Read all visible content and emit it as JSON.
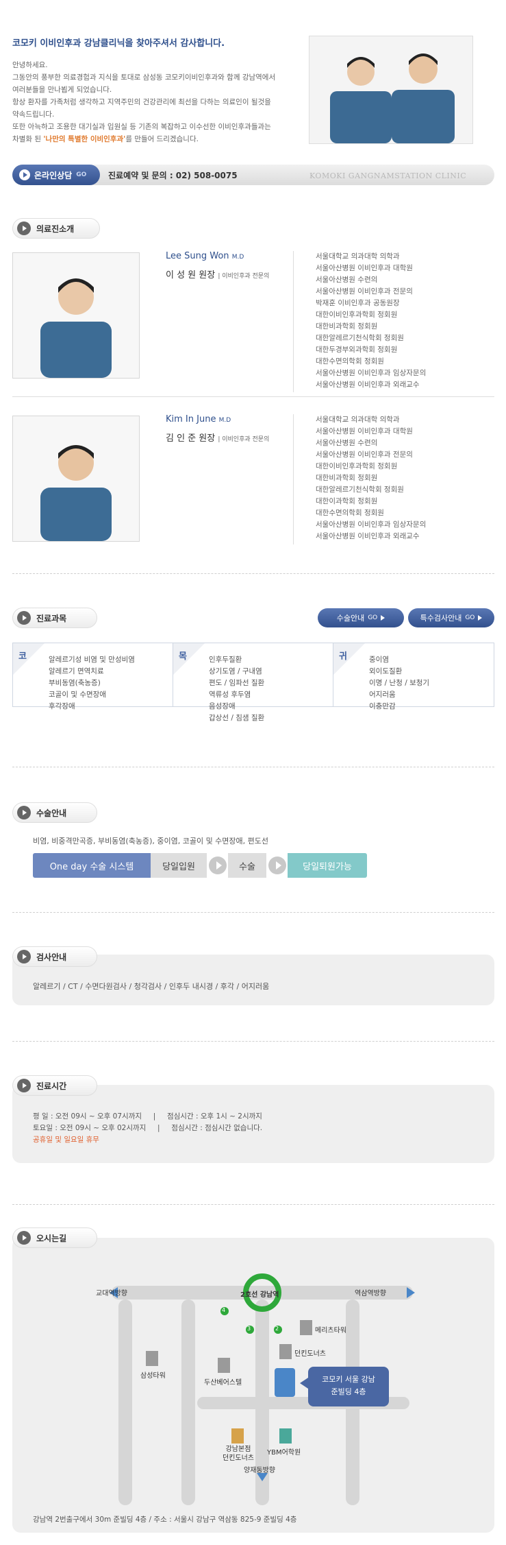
{
  "intro": {
    "title": "코모키 이비인후과 강남클리닉을 찾아주셔서 감사합니다.",
    "p1": "안녕하세요.",
    "p2": "그동안의 풍부한 의료경험과 지식을 토대로 삼성동 코모키이비인후과와 함께 강남역에서",
    "p3": "여러분들을 만나뵙게 되었습니다.",
    "p4": "항상 환자를 가족처럼 생각하고 지역주민의 건강관리에 최선을 다하는 의료인이 될것을",
    "p5": "약속드립니다.",
    "p6": "또한 아늑하고 조용한 대기실과 입원실 등 기존의 복잡하고 이수선한 이비인후과들과는",
    "p7_a": "차별화 된 ",
    "p7_hl": "'나만의 특별한 이비인후과'",
    "p7_b": "를 만들어 드리겠습니다."
  },
  "contact": {
    "online_label": "온라인상담",
    "online_go": "GO",
    "phone_label": "진료예약 및 문의 : 02) 508-0075",
    "brand_en": "KOMOKI GANGNAMSTATION CLINIC"
  },
  "sections": {
    "doctors": "의료진소개",
    "departments": "진료과목",
    "surgery": "수술안내",
    "exam": "검사안내",
    "hours": "진료시간",
    "directions": "오시는길"
  },
  "doctors": [
    {
      "name_en": "Lee Sung Won",
      "md": "M.D",
      "name_ko": "이 성 원 원장",
      "spec": "이비인후과 전문의",
      "career": [
        "서울대학교 의과대학 의학과",
        "서울아산병원 이비인후과 대학원",
        "서울아산병원 수련의",
        "서울아산병원 이비인후과 전문의",
        "박재훈 이비인후과 공동원장",
        "대한이비인후과학회 정회원",
        "대한비과학회 정회원",
        "대한알레르기천식학회 정회원",
        "대한두경부외과학회 정회원",
        "대한수면의학회 정회원",
        "서울아산병원 이비인후과 임상자문의",
        "서울아산병원 이비인후과 외래교수"
      ]
    },
    {
      "name_en": "Kim In June",
      "md": "M.D",
      "name_ko": "김 인 준 원장",
      "spec": "이비인후과 전문의",
      "career": [
        "서울대학교 의과대학 의학과",
        "서울아산병원 이비인후과 대학원",
        "서울아산병원 수련의",
        "서울아산병원 이비인후과 전문의",
        "대한이비인후과학회 정회원",
        "대한비과학회 정회원",
        "대한알레르기천식학회 정회원",
        "대한이과학회 정회원",
        "대한수면의학회 정회원",
        "서울아산병원 이비인후과 임상자문의",
        "서울아산병원 이비인후과 외래교수"
      ]
    }
  ],
  "dept_buttons": {
    "surgery": "수술안내",
    "special_exam": "특수검사안내",
    "go": "GO"
  },
  "departments": [
    {
      "char": "코",
      "items": [
        "알레르기성 비염 및 만성비염",
        "알레르기 면역치료",
        "부비동염(축농증)",
        "코골이 및 수면장애",
        "후각장애"
      ]
    },
    {
      "char": "목",
      "items": [
        "인후두질환",
        "상기도염 / 구내염",
        "편도 / 임파선 질환",
        "역류성 후두염",
        "음성장애",
        "갑상선 / 침샘 질환"
      ]
    },
    {
      "char": "귀",
      "items": [
        "중이염",
        "외이도질환",
        "이명 / 난청 / 보청기",
        "어지러움",
        "이충만감"
      ]
    }
  ],
  "surgery": {
    "list": "비염, 비중격만곡증, 부비동염(축농증), 중이염, 코골이 및 수면장애, 편도선",
    "oneday": "One day 수술 시스템",
    "step1": "당일입원",
    "step2": "수술",
    "step3": "당일퇴원가능"
  },
  "exam": {
    "list": "알레르기 / CT / 수면다원검사 / 청각검사 / 인후두 내시경 / 후각 / 어지러움"
  },
  "hours": {
    "weekday": "평    일 : 오전 09시 ~ 오후 07시까지",
    "lunch": "점심시간 : 오후 1시 ~ 2시까지",
    "sat": "토요일 : 오전 09시 ~ 오후 02시까지",
    "sat_lunch": "점심시간 : 점심시간 없습니다.",
    "sep": "|",
    "holiday": "공휴일 및 일요일 휴무"
  },
  "map": {
    "west": "교대역방향",
    "station": "2호선 강남역",
    "east": "역삼역방향",
    "exits": [
      "4",
      "3",
      "2"
    ],
    "meritz": "메리츠타워",
    "samsung": "삼성타워",
    "dunkin": "던킨도너츠",
    "doosan": "두산베어스텔",
    "clinic_line1": "코모키 서울 강남",
    "clinic_line2": "준빌딩 4층",
    "gangnam_branch1": "강남본점",
    "gangnam_branch2": "던킨도너츠",
    "ybm": "YBM어학원",
    "south": "양재동방향",
    "address": "강남역 2번출구에서 30m 준빌딩 4층 / 주소 : 서울시 강남구 역삼동 825-9 준빌딩 4층"
  },
  "colors": {
    "brand_blue": "#2e4f8c",
    "button_blue": "#4a67a3",
    "accent_orange": "#e07a2e",
    "teal": "#83c9c9",
    "station_green": "#2ea83a"
  }
}
